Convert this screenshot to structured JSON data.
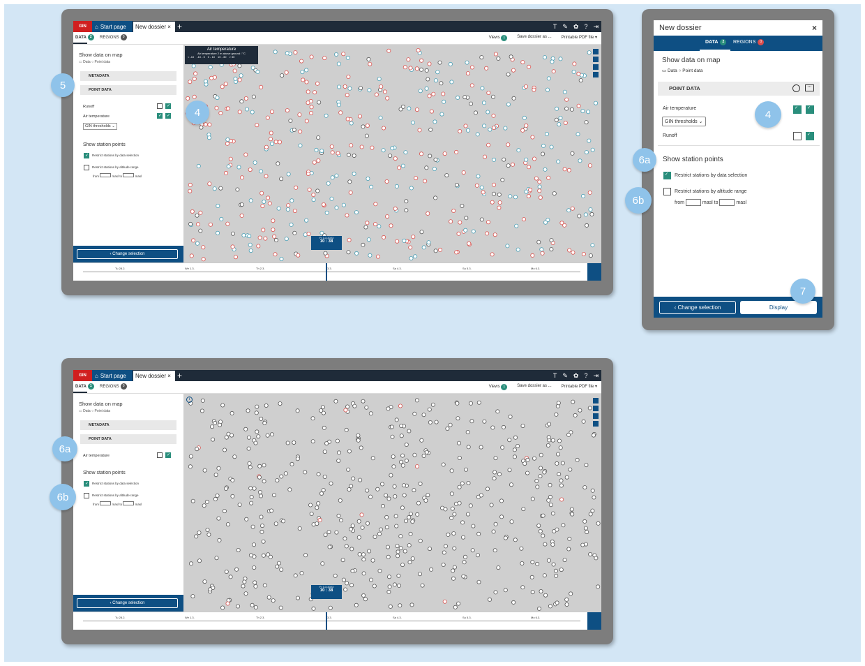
{
  "app": {
    "gin_label": "GIN",
    "start_tab": "Start page",
    "dossier_tab": "New dossier",
    "close_glyph": "×",
    "plus_glyph": "+",
    "top_icons": [
      "T",
      "🔧",
      "⚙",
      "?",
      "⎋"
    ]
  },
  "subbar": {
    "data_tab": "DATA",
    "regions_tab": "REGIONS",
    "data_badge_top": "2",
    "data_badge_bottom": "1",
    "regions_badge": "0",
    "views_label": "Views",
    "views_badge": "1",
    "save_label": "Save dossier as ...",
    "pdf_label": "Printable PDF file ▾"
  },
  "sidebar": {
    "show_data_title": "Show data on map",
    "data_option": "Data",
    "point_option": "Point data",
    "metadata_label": "METADATA",
    "point_data_label": "POINT DATA",
    "runoff_label": "Runoff",
    "air_temp_label": "Air temperature",
    "thresholds_label": "GIN thresholds",
    "show_station_title": "Show station points",
    "restrict_data": "Restrict stations by data selection",
    "restrict_alt": "Restrict stations by altitude range",
    "from_label": "from",
    "masl1": "masl",
    "to_label": "to",
    "masl2": "masl",
    "change_selection": "‹ Change selection"
  },
  "legend": {
    "title": "Air temperature",
    "subtitle": "Air temperature 2 m above ground / °C",
    "items": [
      "< -10",
      "-10 - 0",
      "0 - 10",
      "10 - 30",
      "> 30"
    ]
  },
  "timeline": {
    "labels": [
      "Tu 28.2.",
      "We 1.3.",
      "Th 2.3.",
      "3.3.",
      "Sa 4.3.",
      "Su 5.3.",
      "Mo 6.3."
    ],
    "date": "Fr 3.3.2023",
    "time": "10 : 38"
  },
  "panel": {
    "title": "New dossier",
    "close": "×",
    "data_tab": "DATA",
    "data_badge": "2",
    "regions_tab": "REGIONS",
    "regions_badge": "0",
    "show_data": "Show data on map",
    "data_option": "Data",
    "point_option": "Point data",
    "point_data": "POINT DATA",
    "air_temp": "Air temperature",
    "thresholds": "GIN thresholds",
    "runoff": "Runoff",
    "show_station": "Show station points",
    "restrict_data": "Restrict stations by data selection",
    "restrict_alt": "Restrict stations by altitude range",
    "from_label": "from",
    "masl1": "masl",
    "to_label": "to",
    "masl2": "masl",
    "change_selection": "‹ Change selection",
    "display": "Display"
  },
  "callouts": {
    "c5": "5",
    "c4a": "4",
    "c4b": "4",
    "c6a_panel": "6a",
    "c6b_panel": "6b",
    "c7": "7",
    "c6a_bottom": "6a",
    "c6b_bottom": "6b"
  },
  "colors": {
    "accent": "#0e4f83",
    "topbar": "#1f2b39",
    "check": "#2a8e7c",
    "gin_red": "#d01f1f",
    "callout": "#8fc3ea",
    "background": "#d3e6f5"
  }
}
